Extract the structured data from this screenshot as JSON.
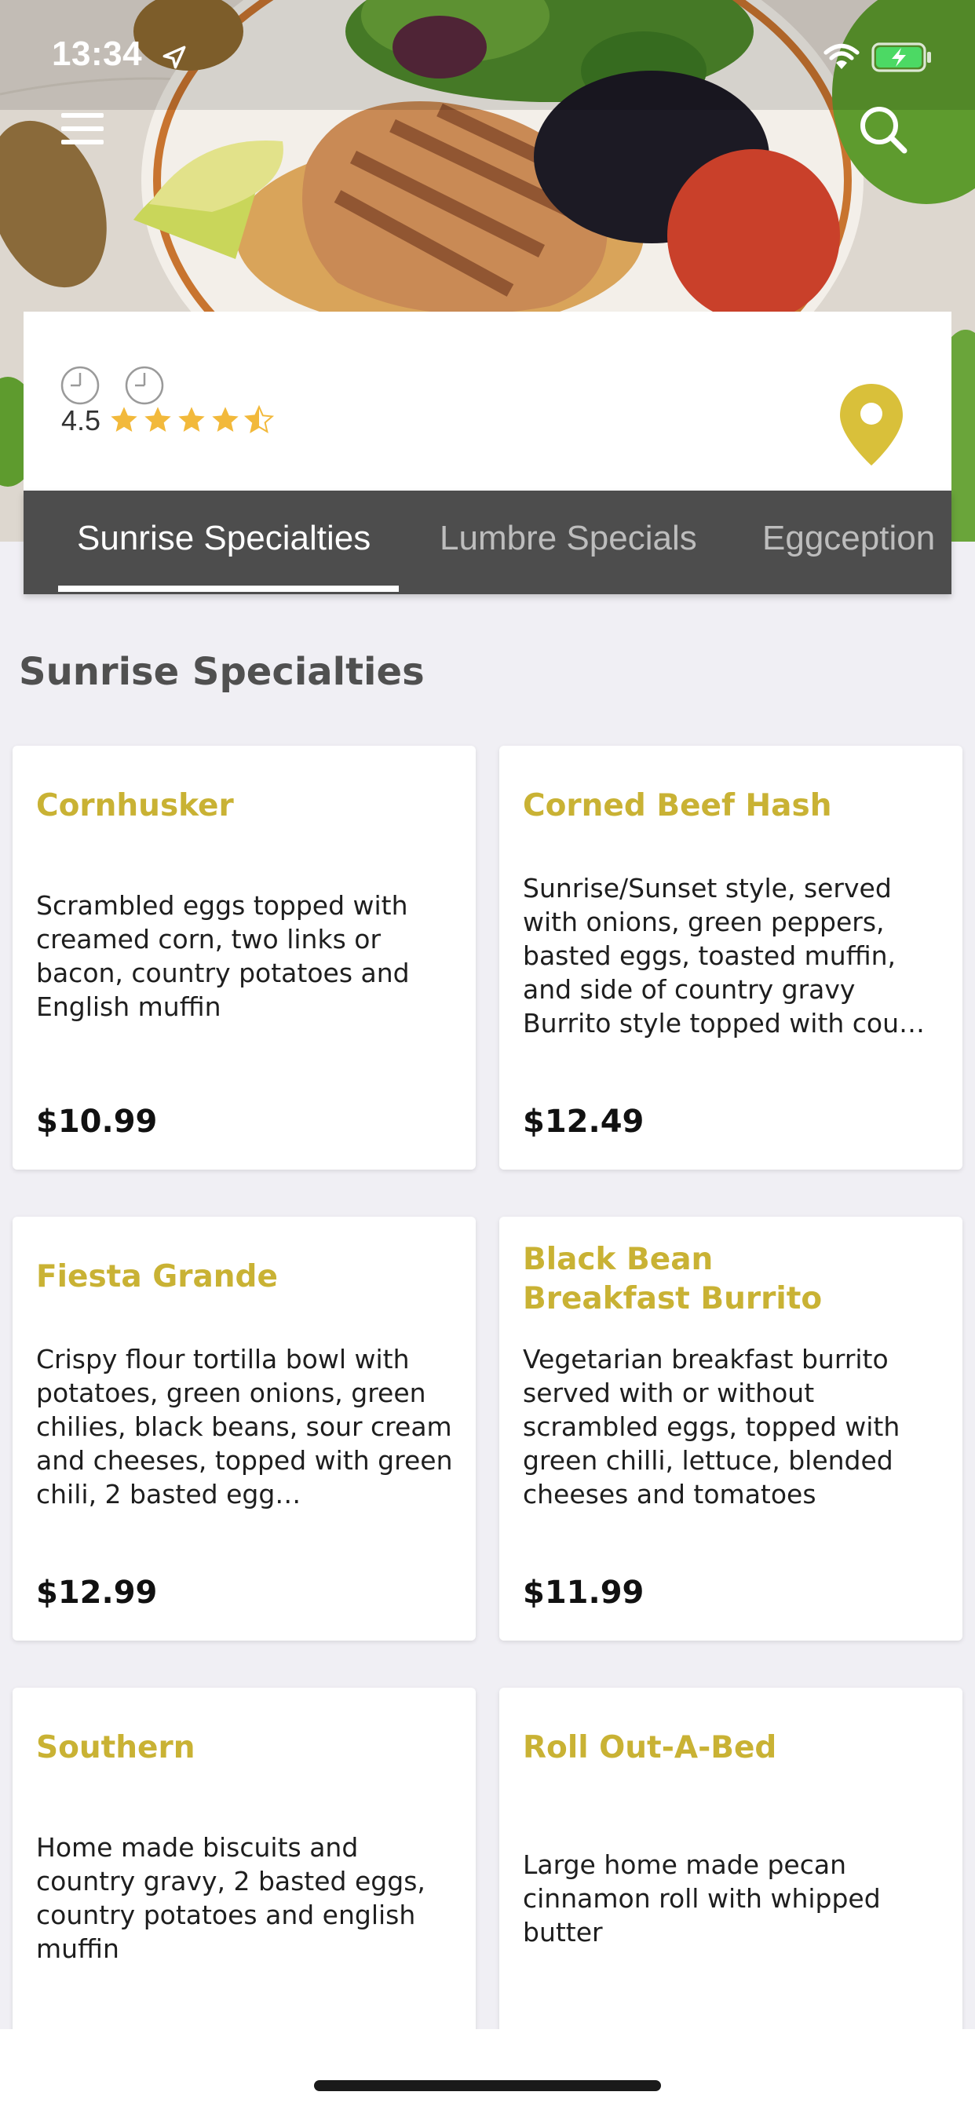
{
  "status_bar": {
    "time": "13:34"
  },
  "restaurant": {
    "rating": "4.5",
    "rating_value": 4.5
  },
  "tabs": [
    {
      "label": "Sunrise Specialties",
      "active": true
    },
    {
      "label": "Lumbre Specials",
      "active": false
    },
    {
      "label": "Eggception",
      "active": false
    }
  ],
  "section": {
    "title": "Sunrise Specialties"
  },
  "menu_items": [
    {
      "name": "Cornhusker",
      "description": "Scrambled eggs topped with creamed corn, two links or bacon, country potatoes and English muffin",
      "price": "$10.99"
    },
    {
      "name": "Corned Beef Hash",
      "description": "Sunrise/Sunset style, served with onions, green peppers, basted eggs, toasted muffin, and side of country gravy Burrito style topped with cou…",
      "price": "$12.49"
    },
    {
      "name": "Fiesta Grande",
      "description": "Crispy flour tortilla bowl with potatoes, green onions, green chilies, black beans, sour cream and cheeses, topped with green chili, 2 basted egg…",
      "price": "$12.99"
    },
    {
      "name": "Black Bean Breakfast Burrito",
      "description": "Vegetarian breakfast burrito served with or without scrambled eggs, topped with green chilli, lettuce, blended cheeses and tomatoes",
      "price": "$11.99"
    },
    {
      "name": "Southern",
      "description": "Home made biscuits and country gravy, 2 basted eggs, country potatoes and english muffin",
      "price": ""
    },
    {
      "name": "Roll Out-A-Bed",
      "description": "Large home made pecan cinnamon roll with whipped butter",
      "price": ""
    }
  ],
  "icons": {
    "menu": "hamburger-icon",
    "search": "search-icon",
    "clock": "clock-icon",
    "star": "star-icon",
    "map_pin": "map-pin-icon",
    "wifi": "wifi-icon",
    "battery": "battery-charging-icon"
  },
  "colors": {
    "accent": "#c9b234",
    "star": "#f2b93b",
    "pin": "#d9c03a",
    "tab_bar": "#4d4d4d",
    "background": "#f0eff4"
  }
}
